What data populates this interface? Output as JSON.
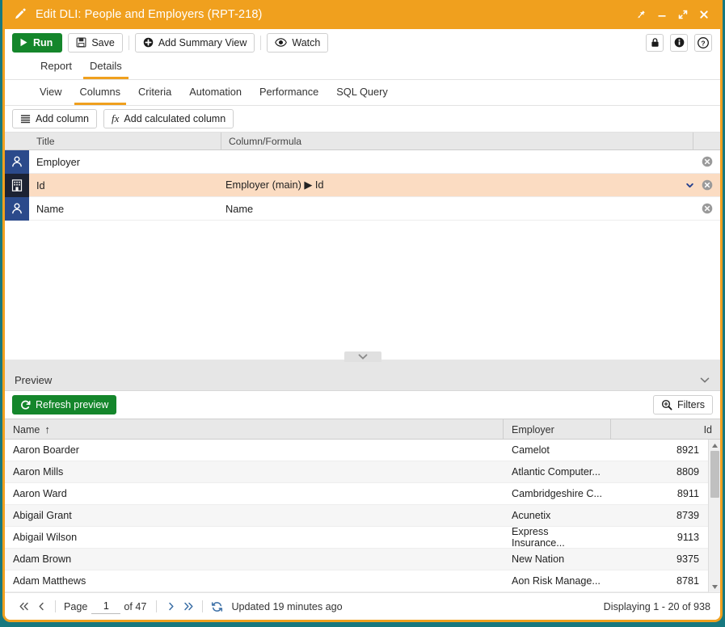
{
  "window": {
    "title": "Edit DLI: People and Employers (RPT-218)",
    "controls": [
      "pin",
      "minimize",
      "maximize",
      "close"
    ],
    "accent_color": "#f0a01e",
    "desktop_color": "#17787f"
  },
  "toolbar": {
    "run_label": "Run",
    "save_label": "Save",
    "add_summary_view_label": "Add Summary View",
    "watch_label": "Watch",
    "lock_title": "lock",
    "info_title": "info",
    "help_title": "help"
  },
  "primary_tabs": [
    {
      "label": "Report",
      "active": false
    },
    {
      "label": "Details",
      "active": true
    }
  ],
  "secondary_tabs": [
    {
      "label": "View",
      "active": false
    },
    {
      "label": "Columns",
      "active": true
    },
    {
      "label": "Criteria",
      "active": false
    },
    {
      "label": "Automation",
      "active": false
    },
    {
      "label": "Performance",
      "active": false
    },
    {
      "label": "SQL Query",
      "active": false
    }
  ],
  "column_actions": {
    "add_column_label": "Add column",
    "add_calculated_column_label": "Add calculated column",
    "fx_label": "fx"
  },
  "columns_grid": {
    "headers": {
      "title": "Title",
      "formula": "Column/Formula"
    },
    "rows": [
      {
        "icon": "person-icon",
        "title": "Employer",
        "formula": "",
        "selected": false,
        "has_dropdown": false
      },
      {
        "icon": "building-icon",
        "title": "Id",
        "formula": "Employer (main) ▶ Id",
        "selected": true,
        "has_dropdown": true
      },
      {
        "icon": "person-icon",
        "title": "Name",
        "formula": "Name",
        "selected": false,
        "has_dropdown": false
      }
    ]
  },
  "preview": {
    "header_label": "Preview",
    "refresh_label": "Refresh preview",
    "filters_label": "Filters",
    "table": {
      "headers": [
        {
          "label": "Name",
          "sort": "↑"
        },
        {
          "label": "Employer",
          "sort": ""
        },
        {
          "label": "Id",
          "sort": ""
        }
      ],
      "rows": [
        {
          "name": "Aaron Boarder",
          "employer": "Camelot",
          "id": "8921"
        },
        {
          "name": "Aaron Mills",
          "employer": "Atlantic Computer...",
          "id": "8809"
        },
        {
          "name": "Aaron Ward",
          "employer": "Cambridgeshire C...",
          "id": "8911"
        },
        {
          "name": "Abigail Grant",
          "employer": "Acunetix",
          "id": "8739"
        },
        {
          "name": "Abigail Wilson",
          "employer": "Express Insurance...",
          "id": "9113"
        },
        {
          "name": "Adam Brown",
          "employer": "New Nation",
          "id": "9375"
        },
        {
          "name": "Adam Matthews",
          "employer": "Aon Risk Manage...",
          "id": "8781"
        }
      ]
    }
  },
  "footer": {
    "first_page_icon": "double-chevron-left-icon",
    "prev_page_icon": "chevron-left-icon",
    "page_label": "Page",
    "page_value": "1",
    "of_label": "of 47",
    "next_page_icon": "chevron-right-icon",
    "last_page_icon": "double-chevron-right-icon",
    "refresh_icon": "refresh-icon",
    "updated_text": "Updated 19 minutes ago",
    "displaying_text": "Displaying 1 - 20 of 938"
  }
}
